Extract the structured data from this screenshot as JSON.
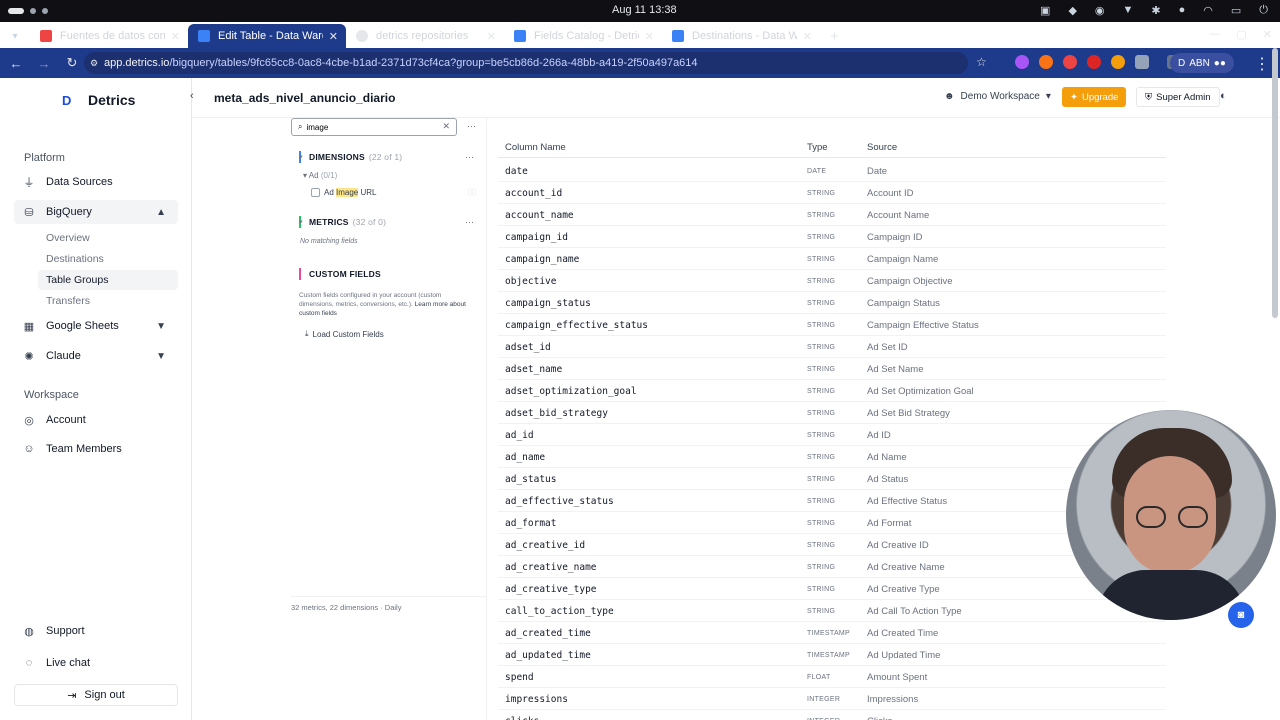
{
  "system": {
    "clock": "Aug 11  13:38"
  },
  "browser": {
    "tabs": [
      {
        "title": "Fuentes de datos conect",
        "color": "#ef4444"
      },
      {
        "title": "Edit Table - Data Wareho",
        "color": "#1d4ed8",
        "active": true
      },
      {
        "title": "detrics repositories",
        "color": "#e5e7eb"
      },
      {
        "title": "Fields Catalog - Detrics",
        "color": "#1d4ed8"
      },
      {
        "title": "Destinations - Data Ware",
        "color": "#1d4ed8"
      }
    ],
    "url_site": "app.detrics.io",
    "url_path": "/bigquery/tables/9fc65cc8-0ac8-4cbe-b1ad-2371d73cf4ca?group=be5cb86d-266a-48bb-a419-2f50a497a614",
    "profile_label": "ABN"
  },
  "brand": {
    "name": "Detrics"
  },
  "sidebar": {
    "platform_label": "Platform",
    "items": {
      "data_sources": "Data Sources",
      "bigquery": "BigQuery",
      "google_sheets": "Google Sheets",
      "claude": "Claude"
    },
    "bigquery_sub": [
      "Overview",
      "Destinations",
      "Table Groups",
      "Transfers"
    ],
    "workspace_label": "Workspace",
    "account": "Account",
    "team_members": "Team Members",
    "support": "Support",
    "live_chat": "Live chat",
    "sign_out": "Sign out"
  },
  "topbar": {
    "title": "meta_ads_nivel_anuncio_diario",
    "workspace": "Demo Workspace",
    "upgrade": "Upgrade",
    "super_admin": "Super Admin"
  },
  "fields": {
    "search_value": "image",
    "dimensions_title": "DIMENSIONS",
    "dimensions_count": "(22 of 1)",
    "ad_group": "Ad",
    "ad_group_count": "(0/1)",
    "field_prefix": "Ad ",
    "field_match": "Image",
    "field_suffix": " URL",
    "metrics_title": "METRICS",
    "metrics_count": "(32 of 0)",
    "no_matching": "No matching fields",
    "custom_title": "CUSTOM FIELDS",
    "custom_note": "Custom fields configured in your account (custom dimensions, metrics, conversions, etc.).",
    "custom_link": "Learn more about custom fields",
    "load_custom": "Load Custom Fields",
    "footer": "32 metrics, 22 dimensions · Daily"
  },
  "table": {
    "headers": {
      "column": "Column Name",
      "type": "Type",
      "source": "Source"
    },
    "rows": [
      [
        "date",
        "DATE",
        "Date"
      ],
      [
        "account_id",
        "STRING",
        "Account ID"
      ],
      [
        "account_name",
        "STRING",
        "Account Name"
      ],
      [
        "campaign_id",
        "STRING",
        "Campaign ID"
      ],
      [
        "campaign_name",
        "STRING",
        "Campaign Name"
      ],
      [
        "objective",
        "STRING",
        "Campaign Objective"
      ],
      [
        "campaign_status",
        "STRING",
        "Campaign Status"
      ],
      [
        "campaign_effective_status",
        "STRING",
        "Campaign Effective Status"
      ],
      [
        "adset_id",
        "STRING",
        "Ad Set ID"
      ],
      [
        "adset_name",
        "STRING",
        "Ad Set Name"
      ],
      [
        "adset_optimization_goal",
        "STRING",
        "Ad Set Optimization Goal"
      ],
      [
        "adset_bid_strategy",
        "STRING",
        "Ad Set Bid Strategy"
      ],
      [
        "ad_id",
        "STRING",
        "Ad ID"
      ],
      [
        "ad_name",
        "STRING",
        "Ad Name"
      ],
      [
        "ad_status",
        "STRING",
        "Ad Status"
      ],
      [
        "ad_effective_status",
        "STRING",
        "Ad Effective Status"
      ],
      [
        "ad_format",
        "STRING",
        "Ad Format"
      ],
      [
        "ad_creative_id",
        "STRING",
        "Ad Creative ID"
      ],
      [
        "ad_creative_name",
        "STRING",
        "Ad Creative Name"
      ],
      [
        "ad_creative_type",
        "STRING",
        "Ad Creative Type"
      ],
      [
        "call_to_action_type",
        "STRING",
        "Ad Call To Action Type"
      ],
      [
        "ad_created_time",
        "TIMESTAMP",
        "Ad Created Time"
      ],
      [
        "ad_updated_time",
        "TIMESTAMP",
        "Ad Updated Time"
      ],
      [
        "spend",
        "FLOAT",
        "Amount Spent"
      ],
      [
        "impressions",
        "INTEGER",
        "Impressions"
      ],
      [
        "clicks",
        "INTEGER",
        "Clicks"
      ]
    ]
  },
  "colors": {
    "accent": "#1d4ed8",
    "upgrade": "#f59e0b",
    "highlight": "#fde68a"
  }
}
